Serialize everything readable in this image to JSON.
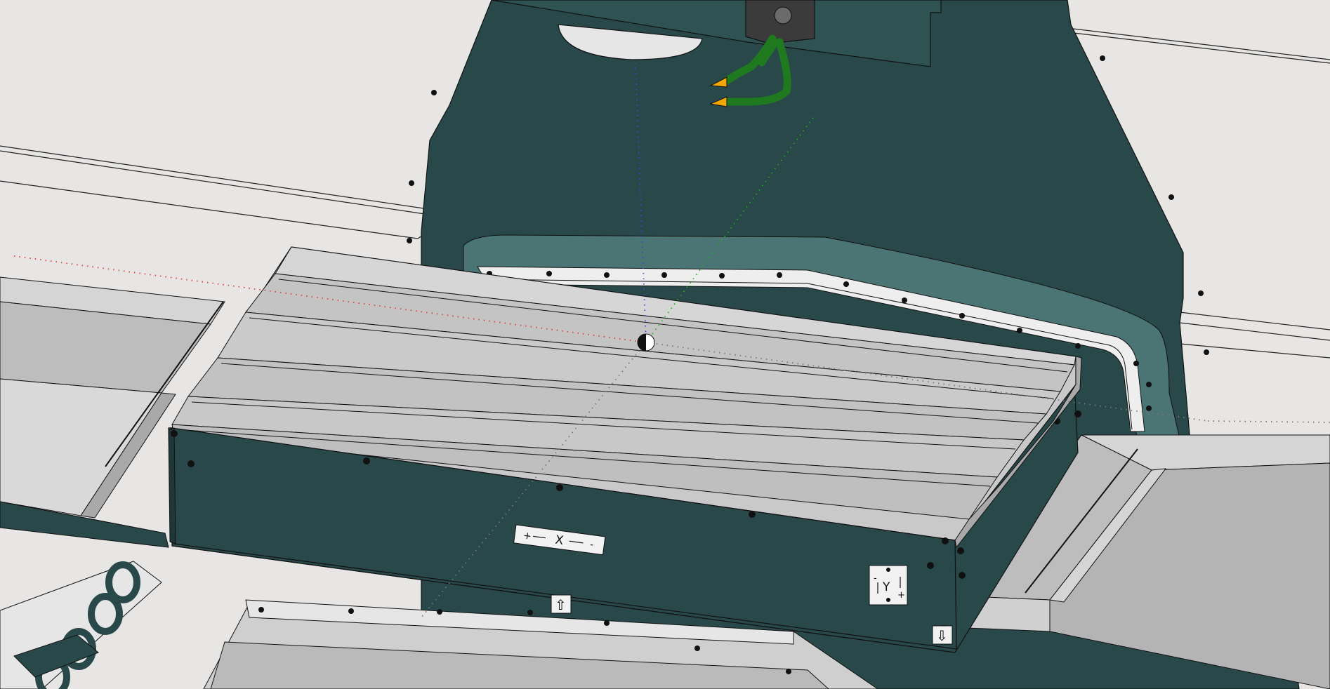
{
  "scene": {
    "colors": {
      "background": "#e8e6e5",
      "machine_body": "#29484a",
      "machine_body_light": "#3f6a6b",
      "machine_highlight": "#5b8786",
      "table_top": "#c7c7c7",
      "table_light": "#dcdcdc",
      "cover": "#bdbdbd",
      "cover_light": "#d6d6d6",
      "coolant_hose": "#1f7a1f",
      "nozzle_tip": "#f0a800",
      "axis_x": "#e23b3b",
      "axis_y": "#22aa22",
      "axis_z": "#3a49d6",
      "edge": "#111111"
    },
    "icons": {
      "origin_marker": "origin-marker-icon",
      "arrow_up": "arrow-up-icon",
      "arrow_down": "arrow-down-icon"
    },
    "labels": {
      "x_axis_plate": {
        "plus": "+",
        "axis": "X",
        "minus": "-"
      },
      "y_axis_plate": {
        "minus": "-",
        "axis": "Y",
        "plus": "+"
      },
      "up_arrow_glyph": "⇧",
      "down_arrow_glyph": "⇩"
    }
  }
}
